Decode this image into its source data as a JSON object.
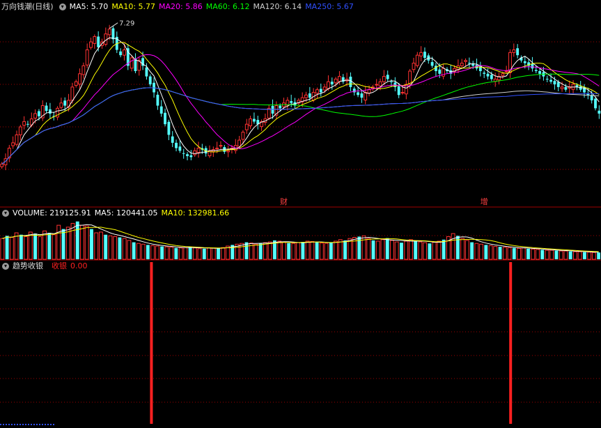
{
  "colors": {
    "up": "#ff3232",
    "down": "#54ffff",
    "grid": "#a00000",
    "divider": "#a00000",
    "ma5": "#ffffff",
    "ma10": "#ffff00",
    "ma20": "#ff00ff",
    "ma60": "#00ff00",
    "ma120": "#d0d0d0",
    "ma250": "#3050ff",
    "signal": "#ff2020",
    "text": "#dddddd"
  },
  "price_legend": {
    "title": "万向钱潮(日线)",
    "ma5_label": "MA5: 5.70",
    "ma10_label": "MA10: 5.77",
    "ma20_label": "MA20: 5.86",
    "ma60_label": "MA60: 6.12",
    "ma120_label": "MA120: 6.14",
    "ma250_label": "MA250: 5.67"
  },
  "volume_legend": {
    "volume_label": "VOLUME: 219125.91",
    "ma5_label": "MA5: 120441.05",
    "ma10_label": "MA10: 132981.66"
  },
  "indicator_legend": {
    "name": "趋势收银",
    "series_label": "收银",
    "value": "0.00"
  },
  "chart_data": [
    {
      "type": "candlestick",
      "high_label": "7.29",
      "ylim": [
        4.4,
        7.55
      ],
      "markers": [
        {
          "index": 76,
          "text": "财"
        },
        {
          "index": 130,
          "text": "增"
        }
      ],
      "closes": [
        4.75,
        4.85,
        5.05,
        5.15,
        5.3,
        5.45,
        5.55,
        5.5,
        5.6,
        5.7,
        5.65,
        5.85,
        5.75,
        5.7,
        5.65,
        5.8,
        5.9,
        5.85,
        5.95,
        6.2,
        6.3,
        6.45,
        6.6,
        6.9,
        7.05,
        7.15,
        6.95,
        7.05,
        7.2,
        7.29,
        7.1,
        6.9,
        6.8,
        6.9,
        6.6,
        6.75,
        6.5,
        6.7,
        6.6,
        6.4,
        6.25,
        6.1,
        5.85,
        5.7,
        5.5,
        5.3,
        5.15,
        5.05,
        5.0,
        4.95,
        4.9,
        4.88,
        5.0,
        5.05,
        5.02,
        4.95,
        5.0,
        5.02,
        5.05,
        5.1,
        4.98,
        5.0,
        5.05,
        5.1,
        5.2,
        5.35,
        5.5,
        5.6,
        5.55,
        5.5,
        5.55,
        5.6,
        5.8,
        5.7,
        5.85,
        5.8,
        5.9,
        5.95,
        5.9,
        5.85,
        5.95,
        6.0,
        6.05,
        6.0,
        6.1,
        6.15,
        6.1,
        6.2,
        6.3,
        6.25,
        6.35,
        6.4,
        6.3,
        6.35,
        6.2,
        6.1,
        6.05,
        6.0,
        6.1,
        6.15,
        6.2,
        6.25,
        6.3,
        6.4,
        6.35,
        6.3,
        6.2,
        6.05,
        6.1,
        6.25,
        6.5,
        6.65,
        6.8,
        6.85,
        6.75,
        6.7,
        6.6,
        6.5,
        6.45,
        6.55,
        6.5,
        6.45,
        6.55,
        6.6,
        6.65,
        6.7,
        6.65,
        6.6,
        6.55,
        6.5,
        6.45,
        6.4,
        6.35,
        6.35,
        6.4,
        6.45,
        6.5,
        6.85,
        6.9,
        6.8,
        6.7,
        6.65,
        6.6,
        6.55,
        6.5,
        6.45,
        6.4,
        6.35,
        6.3,
        6.25,
        6.2,
        6.2,
        6.15,
        6.2,
        6.25,
        6.2,
        6.15,
        6.1,
        6.05,
        5.95,
        5.8,
        5.7
      ],
      "bars": [
        {
          "volume": [
            0.55,
            0.62,
            0.58,
            0.7,
            0.65,
            0.6,
            0.72,
            0.68,
            0.6,
            0.75,
            0.7,
            0.65,
            0.9,
            0.8,
            0.85,
            0.95,
            1.0,
            0.9,
            0.88,
            0.8,
            0.7,
            0.72,
            0.65,
            0.62,
            0.6,
            0.58,
            0.55,
            0.5,
            0.45,
            0.42,
            0.4,
            0.38,
            0.36,
            0.35,
            0.34,
            0.33,
            0.32,
            0.3,
            0.3,
            0.31,
            0.33,
            0.3,
            0.28,
            0.28,
            0.3,
            0.3,
            0.29,
            0.31,
            0.35,
            0.38,
            0.4,
            0.42,
            0.45,
            0.43,
            0.4,
            0.42,
            0.44,
            0.46,
            0.5,
            0.48,
            0.45,
            0.43,
            0.42,
            0.44,
            0.46,
            0.48,
            0.47,
            0.45,
            0.43,
            0.42,
            0.44,
            0.48,
            0.52,
            0.5,
            0.55,
            0.58,
            0.6,
            0.62,
            0.55,
            0.5,
            0.48,
            0.52,
            0.56,
            0.5,
            0.46,
            0.44,
            0.48,
            0.52,
            0.5,
            0.46,
            0.44,
            0.42,
            0.45,
            0.48,
            0.52,
            0.6,
            0.68,
            0.62,
            0.55,
            0.5,
            0.45,
            0.42,
            0.4,
            0.38,
            0.36,
            0.34,
            0.33,
            0.32,
            0.31,
            0.3,
            0.29,
            0.3,
            0.28,
            0.27,
            0.26,
            0.25,
            0.24,
            0.24,
            0.23,
            0.22,
            0.22,
            0.21,
            0.2,
            0.2,
            0.19,
            0.19,
            0.18,
            0.18
          ]
        }
      ]
    },
    {
      "type": "bar",
      "name": "VOLUME"
    },
    {
      "type": "bar",
      "name": "收银",
      "signal_indices": [
        64,
        217
      ],
      "signal_value": 1
    }
  ]
}
